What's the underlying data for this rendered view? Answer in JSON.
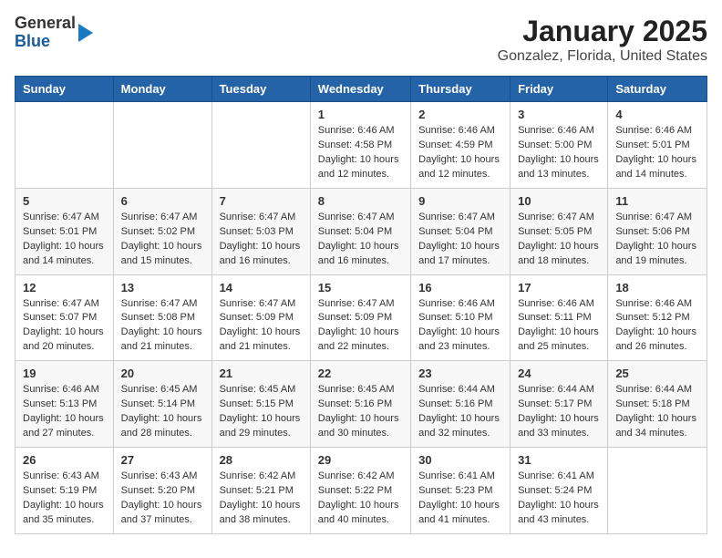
{
  "header": {
    "logo": {
      "general": "General",
      "blue": "Blue",
      "arrow": "arrow-right-icon"
    },
    "title": "January 2025",
    "subtitle": "Gonzalez, Florida, United States"
  },
  "calendar": {
    "days_of_week": [
      "Sunday",
      "Monday",
      "Tuesday",
      "Wednesday",
      "Thursday",
      "Friday",
      "Saturday"
    ],
    "weeks": [
      {
        "cells": [
          {
            "day": "",
            "sunrise": "",
            "sunset": "",
            "daylight": ""
          },
          {
            "day": "",
            "sunrise": "",
            "sunset": "",
            "daylight": ""
          },
          {
            "day": "",
            "sunrise": "",
            "sunset": "",
            "daylight": ""
          },
          {
            "day": "1",
            "sunrise": "Sunrise: 6:46 AM",
            "sunset": "Sunset: 4:58 PM",
            "daylight": "Daylight: 10 hours and 12 minutes."
          },
          {
            "day": "2",
            "sunrise": "Sunrise: 6:46 AM",
            "sunset": "Sunset: 4:59 PM",
            "daylight": "Daylight: 10 hours and 12 minutes."
          },
          {
            "day": "3",
            "sunrise": "Sunrise: 6:46 AM",
            "sunset": "Sunset: 5:00 PM",
            "daylight": "Daylight: 10 hours and 13 minutes."
          },
          {
            "day": "4",
            "sunrise": "Sunrise: 6:46 AM",
            "sunset": "Sunset: 5:01 PM",
            "daylight": "Daylight: 10 hours and 14 minutes."
          }
        ]
      },
      {
        "cells": [
          {
            "day": "5",
            "sunrise": "Sunrise: 6:47 AM",
            "sunset": "Sunset: 5:01 PM",
            "daylight": "Daylight: 10 hours and 14 minutes."
          },
          {
            "day": "6",
            "sunrise": "Sunrise: 6:47 AM",
            "sunset": "Sunset: 5:02 PM",
            "daylight": "Daylight: 10 hours and 15 minutes."
          },
          {
            "day": "7",
            "sunrise": "Sunrise: 6:47 AM",
            "sunset": "Sunset: 5:03 PM",
            "daylight": "Daylight: 10 hours and 16 minutes."
          },
          {
            "day": "8",
            "sunrise": "Sunrise: 6:47 AM",
            "sunset": "Sunset: 5:04 PM",
            "daylight": "Daylight: 10 hours and 16 minutes."
          },
          {
            "day": "9",
            "sunrise": "Sunrise: 6:47 AM",
            "sunset": "Sunset: 5:04 PM",
            "daylight": "Daylight: 10 hours and 17 minutes."
          },
          {
            "day": "10",
            "sunrise": "Sunrise: 6:47 AM",
            "sunset": "Sunset: 5:05 PM",
            "daylight": "Daylight: 10 hours and 18 minutes."
          },
          {
            "day": "11",
            "sunrise": "Sunrise: 6:47 AM",
            "sunset": "Sunset: 5:06 PM",
            "daylight": "Daylight: 10 hours and 19 minutes."
          }
        ]
      },
      {
        "cells": [
          {
            "day": "12",
            "sunrise": "Sunrise: 6:47 AM",
            "sunset": "Sunset: 5:07 PM",
            "daylight": "Daylight: 10 hours and 20 minutes."
          },
          {
            "day": "13",
            "sunrise": "Sunrise: 6:47 AM",
            "sunset": "Sunset: 5:08 PM",
            "daylight": "Daylight: 10 hours and 21 minutes."
          },
          {
            "day": "14",
            "sunrise": "Sunrise: 6:47 AM",
            "sunset": "Sunset: 5:09 PM",
            "daylight": "Daylight: 10 hours and 21 minutes."
          },
          {
            "day": "15",
            "sunrise": "Sunrise: 6:47 AM",
            "sunset": "Sunset: 5:09 PM",
            "daylight": "Daylight: 10 hours and 22 minutes."
          },
          {
            "day": "16",
            "sunrise": "Sunrise: 6:46 AM",
            "sunset": "Sunset: 5:10 PM",
            "daylight": "Daylight: 10 hours and 23 minutes."
          },
          {
            "day": "17",
            "sunrise": "Sunrise: 6:46 AM",
            "sunset": "Sunset: 5:11 PM",
            "daylight": "Daylight: 10 hours and 25 minutes."
          },
          {
            "day": "18",
            "sunrise": "Sunrise: 6:46 AM",
            "sunset": "Sunset: 5:12 PM",
            "daylight": "Daylight: 10 hours and 26 minutes."
          }
        ]
      },
      {
        "cells": [
          {
            "day": "19",
            "sunrise": "Sunrise: 6:46 AM",
            "sunset": "Sunset: 5:13 PM",
            "daylight": "Daylight: 10 hours and 27 minutes."
          },
          {
            "day": "20",
            "sunrise": "Sunrise: 6:45 AM",
            "sunset": "Sunset: 5:14 PM",
            "daylight": "Daylight: 10 hours and 28 minutes."
          },
          {
            "day": "21",
            "sunrise": "Sunrise: 6:45 AM",
            "sunset": "Sunset: 5:15 PM",
            "daylight": "Daylight: 10 hours and 29 minutes."
          },
          {
            "day": "22",
            "sunrise": "Sunrise: 6:45 AM",
            "sunset": "Sunset: 5:16 PM",
            "daylight": "Daylight: 10 hours and 30 minutes."
          },
          {
            "day": "23",
            "sunrise": "Sunrise: 6:44 AM",
            "sunset": "Sunset: 5:16 PM",
            "daylight": "Daylight: 10 hours and 32 minutes."
          },
          {
            "day": "24",
            "sunrise": "Sunrise: 6:44 AM",
            "sunset": "Sunset: 5:17 PM",
            "daylight": "Daylight: 10 hours and 33 minutes."
          },
          {
            "day": "25",
            "sunrise": "Sunrise: 6:44 AM",
            "sunset": "Sunset: 5:18 PM",
            "daylight": "Daylight: 10 hours and 34 minutes."
          }
        ]
      },
      {
        "cells": [
          {
            "day": "26",
            "sunrise": "Sunrise: 6:43 AM",
            "sunset": "Sunset: 5:19 PM",
            "daylight": "Daylight: 10 hours and 35 minutes."
          },
          {
            "day": "27",
            "sunrise": "Sunrise: 6:43 AM",
            "sunset": "Sunset: 5:20 PM",
            "daylight": "Daylight: 10 hours and 37 minutes."
          },
          {
            "day": "28",
            "sunrise": "Sunrise: 6:42 AM",
            "sunset": "Sunset: 5:21 PM",
            "daylight": "Daylight: 10 hours and 38 minutes."
          },
          {
            "day": "29",
            "sunrise": "Sunrise: 6:42 AM",
            "sunset": "Sunset: 5:22 PM",
            "daylight": "Daylight: 10 hours and 40 minutes."
          },
          {
            "day": "30",
            "sunrise": "Sunrise: 6:41 AM",
            "sunset": "Sunset: 5:23 PM",
            "daylight": "Daylight: 10 hours and 41 minutes."
          },
          {
            "day": "31",
            "sunrise": "Sunrise: 6:41 AM",
            "sunset": "Sunset: 5:24 PM",
            "daylight": "Daylight: 10 hours and 43 minutes."
          },
          {
            "day": "",
            "sunrise": "",
            "sunset": "",
            "daylight": ""
          }
        ]
      }
    ]
  }
}
